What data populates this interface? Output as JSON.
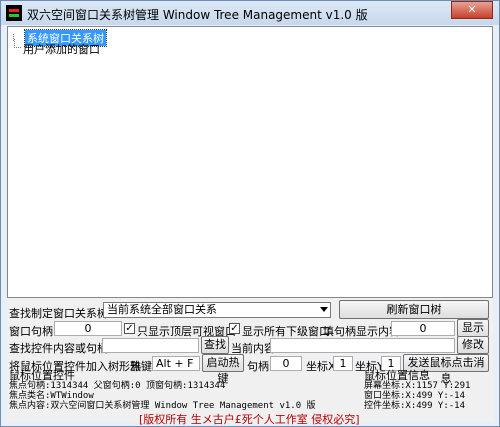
{
  "window": {
    "title": "双六空间窗口关系树管理 Window Tree Management v1.0 版",
    "close_label": "✕"
  },
  "tree": {
    "root_label": "系统窗口关系树",
    "child_label": "用户添加的窗口"
  },
  "row1": {
    "find_label": "查找制定窗口关系树",
    "select_value": "当前系统全部窗口关系",
    "refresh_button": "刷新窗口树"
  },
  "row2": {
    "handle_label": "窗口句柄",
    "handle_value": "0",
    "only_top_label": "只显示顶层可视窗口",
    "only_top_checked": true,
    "show_all_label": "显示所有下级窗口",
    "show_all_checked": true,
    "fill_label": "填句柄显示内容",
    "fill_value": "0",
    "show_button": "显示"
  },
  "row3": {
    "find_ctrl_label": "查找控件内容或句柄",
    "find_button": "查找",
    "current_label": "当前内容",
    "modify_button": "修改"
  },
  "row4": {
    "add_label": "将鼠标位置控件加入树形雅",
    "hotkey_label": "热键",
    "hotkey_value": "Alt + F",
    "start_button": "启动热键",
    "handle_label": "句柄",
    "handle_value": "0",
    "x_label": "坐标X",
    "x_value": "1",
    "y_label": "坐标Y",
    "y_value": "1",
    "send_button": "发送鼠标点击消息"
  },
  "info_left": {
    "group_title": "鼠标位置控件",
    "line1": "焦点句柄:1314344  父窗句柄:0  顶窗句柄:1314344",
    "line2": "焦点类名:WTWindow",
    "line3": "焦点内容:双六空间窗口关系树管理 Window Tree Management v1.0 版"
  },
  "info_right": {
    "group_title": "鼠标位置信息",
    "line1": "屏幕坐标:X:1157 Y:291",
    "line2": "窗口坐标:X:499 Y:-14",
    "line3": "控件坐标:X:499 Y:-14"
  },
  "footer": {
    "copyright": "[版权所有 生メ古户£死个人工作室 侵权必究]"
  }
}
